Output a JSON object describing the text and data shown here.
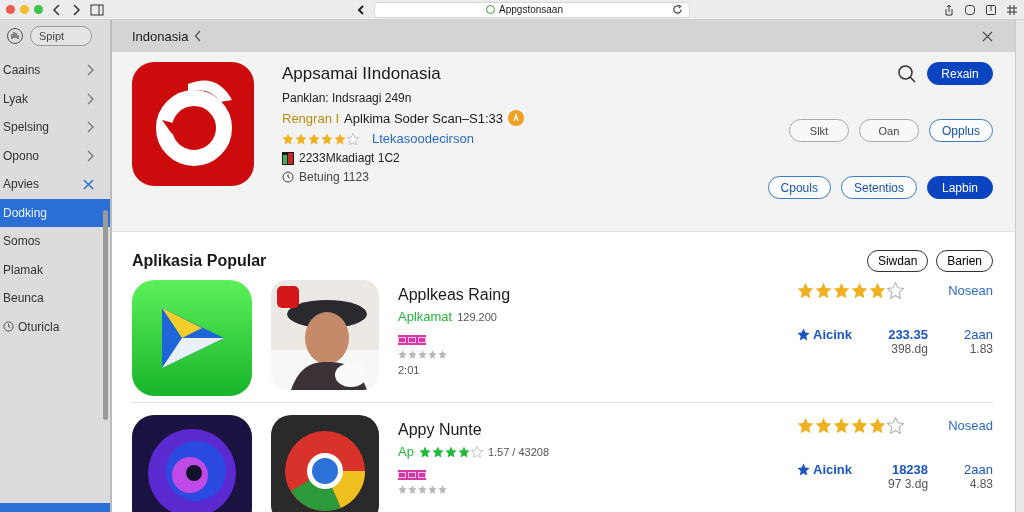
{
  "browser": {
    "address": "Appgstonsaan"
  },
  "sidebar": {
    "search": {
      "placeholder": "Spipt"
    },
    "items": [
      {
        "label": "Caains",
        "kind": "chevron",
        "selected": false
      },
      {
        "label": "Lyak",
        "kind": "chevron",
        "selected": false
      },
      {
        "label": "Spelsing",
        "kind": "chevron",
        "selected": false
      },
      {
        "label": "Opono",
        "kind": "chevron",
        "selected": false
      },
      {
        "label": "Apvies",
        "kind": "close",
        "selected": false
      },
      {
        "label": "Dodking",
        "kind": "plain",
        "selected": true
      },
      {
        "label": "Somos",
        "kind": "plain",
        "selected": false
      },
      {
        "label": "Plamak",
        "kind": "plain",
        "selected": false
      },
      {
        "label": "Beunca",
        "kind": "plain",
        "selected": false
      },
      {
        "label": "Oturicla",
        "kind": "clock",
        "selected": false
      }
    ]
  },
  "header": {
    "title": "Indonasia"
  },
  "hero": {
    "title": "Appsamai IIndonasia",
    "line_1": "Panklan: Indsraagi 249n",
    "category": "Rengran I",
    "line_2": "Aplkima Soder Scan–S1:33",
    "stars": 5,
    "link": "Ltekasoodecirson",
    "downloads": "2233Mkadiagt 1C2",
    "updated": "Betuing 1123",
    "buttons": [
      {
        "label": "Rexain",
        "kind": "filled"
      },
      {
        "label": "Slkt",
        "kind": "grey"
      },
      {
        "label": "Oan",
        "kind": "grey"
      },
      {
        "label": "Opplus",
        "kind": "blue"
      },
      {
        "label": "Cpouls",
        "kind": "blue"
      },
      {
        "label": "Setentios",
        "kind": "blue"
      },
      {
        "label": "Lapbin",
        "kind": "filled"
      }
    ]
  },
  "popular": {
    "title": "Aplikasia Popular",
    "buttons": [
      "Siwdan",
      "Barien"
    ],
    "rows": [
      {
        "kind": "play",
        "title": "Applkeas Raing",
        "sub_prefix": "Aplkamat",
        "sub_text": "129.200",
        "tag_rating": {
          "stars": 0
        },
        "time": "2:01",
        "stars": 5,
        "link": "Nosean",
        "action": "Aicink",
        "value_1": "233.35",
        "value_1_sub": "398.dg",
        "value_2": "2aan",
        "value_2_sub": "1.83"
      },
      {
        "kind": "spiral",
        "title": "Appy Nunte",
        "sub_prefix": "Ap",
        "sub_rating": {
          "stars": 4
        },
        "sub_text": "1.57 / 43208",
        "tag_rating": {
          "stars": 0
        },
        "stars": 5,
        "link": "Nosead",
        "action": "Aicink",
        "value_1": "18238",
        "value_1_sub": "97 3.dg",
        "value_2": "2aan",
        "value_2_sub": "4.83"
      }
    ]
  }
}
